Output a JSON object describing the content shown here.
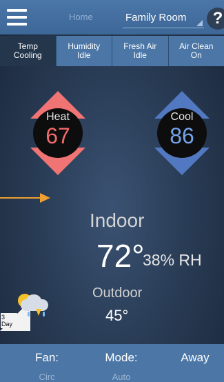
{
  "header": {
    "home_label": "Home",
    "room_label": "Family Room",
    "help_label": "?"
  },
  "tabs": [
    {
      "line1": "Temp",
      "line2": "Cooling"
    },
    {
      "line1": "Humidity",
      "line2": "Idle"
    },
    {
      "line1": "Fresh Air",
      "line2": "Idle"
    },
    {
      "line1": "Air Clean",
      "line2": "On"
    }
  ],
  "heat": {
    "label": "Heat",
    "value": "67"
  },
  "cool": {
    "label": "Cool",
    "value": "86"
  },
  "indoor": {
    "label": "Indoor",
    "temp": "72",
    "degree": "°",
    "humidity": "38% RH"
  },
  "outdoor": {
    "label": "Outdoor",
    "temp": "45°"
  },
  "forecast": {
    "days_line1": "3",
    "days_line2": "Day"
  },
  "bottom": {
    "fan": {
      "label": "Fan:",
      "value": "Circ"
    },
    "mode": {
      "label": "Mode:",
      "value": "Auto"
    },
    "away": {
      "label": "Away"
    }
  },
  "colors": {
    "accent": "#4b76a6",
    "heat": "#f07474",
    "cool": "#5178c0",
    "arrow": "#f0a030"
  }
}
